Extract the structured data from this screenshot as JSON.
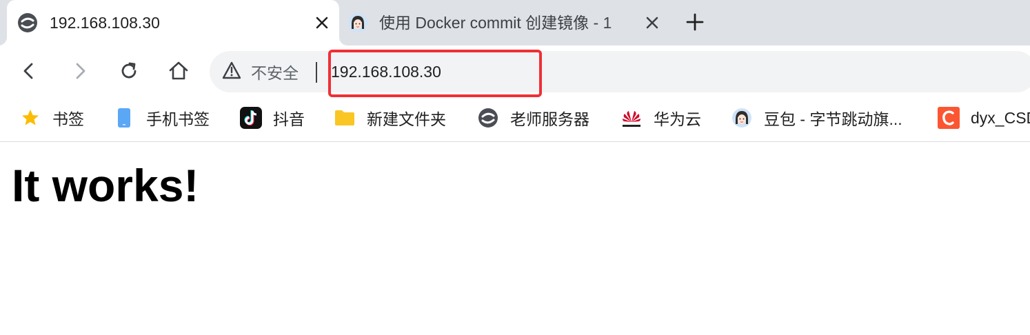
{
  "tabs": [
    {
      "title": "192.168.108.30",
      "icon": "edge-style-browser-icon",
      "active": true
    },
    {
      "title": "使用 Docker commit 创建镜像 - 1",
      "icon": "doubao-avatar-icon",
      "active": false
    }
  ],
  "address_bar": {
    "security_label": "不安全",
    "url": "192.168.108.30"
  },
  "bookmarks": [
    {
      "label": "书签",
      "icon": "star-icon"
    },
    {
      "label": "手机书签",
      "icon": "mobile-icon"
    },
    {
      "label": "抖音",
      "icon": "douyin-icon"
    },
    {
      "label": "新建文件夹",
      "icon": "folder-icon"
    },
    {
      "label": "老师服务器",
      "icon": "edge-style-browser-icon"
    },
    {
      "label": "华为云",
      "icon": "huawei-icon"
    },
    {
      "label": "豆包 - 字节跳动旗...",
      "icon": "doubao-avatar-icon"
    },
    {
      "label": "dyx_CSDN",
      "icon": "csdn-icon"
    }
  ],
  "page": {
    "heading": "It works!"
  },
  "colors": {
    "tabstrip_bg": "#dee1e6",
    "omnibox_bg": "#f1f3f4",
    "highlight": "#ef2f35",
    "star": "#fbbc04",
    "folder": "#f9c623",
    "csdn": "#fc5531"
  }
}
